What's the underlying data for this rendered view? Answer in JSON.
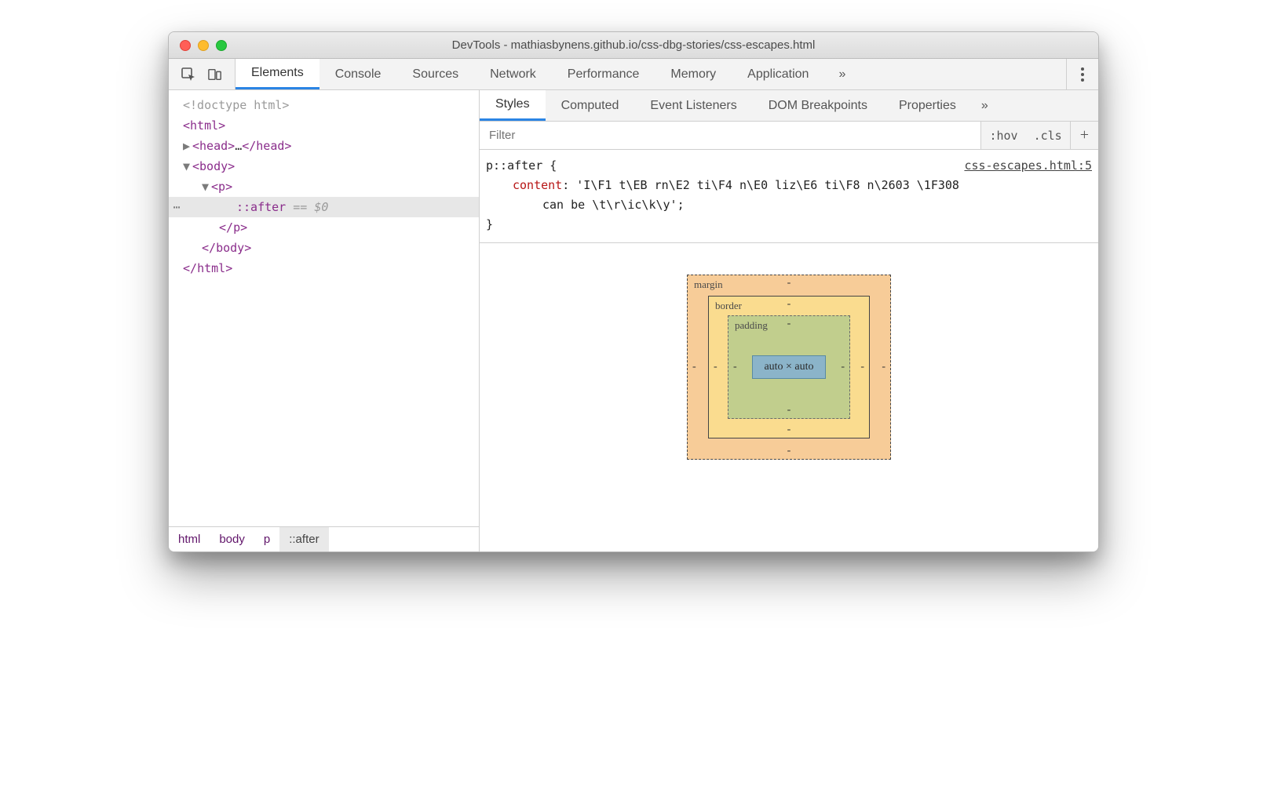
{
  "window": {
    "title": "DevTools - mathiasbynens.github.io/css-dbg-stories/css-escapes.html"
  },
  "toolbar": {
    "tabs": [
      "Elements",
      "Console",
      "Sources",
      "Network",
      "Performance",
      "Memory",
      "Application"
    ],
    "active_tab": 0,
    "overflow_glyph": "»"
  },
  "dom": {
    "doctype": "<!doctype html>",
    "html_open": "html",
    "head_open": "head",
    "head_ellipsis": "…",
    "head_close": "head",
    "body_open": "body",
    "p_open": "p",
    "selected_pseudo": "::after",
    "selected_marker": "== $0",
    "p_close": "p",
    "body_close": "body",
    "html_close": "html"
  },
  "breadcrumb": {
    "items": [
      "html",
      "body",
      "p",
      "::after"
    ],
    "active_index": 3
  },
  "styles": {
    "subtabs": [
      "Styles",
      "Computed",
      "Event Listeners",
      "DOM Breakpoints",
      "Properties"
    ],
    "subtabs_active": 0,
    "subtabs_overflow": "»",
    "filter_placeholder": "Filter",
    "filter_buttons": {
      "hov": ":hov",
      "cls": ".cls",
      "plus": "+"
    },
    "rule": {
      "selector": "p::after {",
      "source": "css-escapes.html:5",
      "prop_name": "content",
      "prop_value_l1": ": 'I\\F1 t\\EB rn\\E2 ti\\F4 n\\E0 liz\\E6 ti\\F8 n\\2603 \\1F308",
      "prop_value_l2": "can be \\t\\r\\ic\\k\\y';",
      "close_brace": "}"
    }
  },
  "box_model": {
    "margin": {
      "label": "margin",
      "top": "-",
      "right": "-",
      "bottom": "-",
      "left": "-"
    },
    "border": {
      "label": "border",
      "top": "-",
      "right": "-",
      "bottom": "-",
      "left": "-"
    },
    "padding": {
      "label": "padding",
      "top": "-",
      "right": "-",
      "bottom": "-",
      "left": "-"
    },
    "content": "auto × auto"
  }
}
